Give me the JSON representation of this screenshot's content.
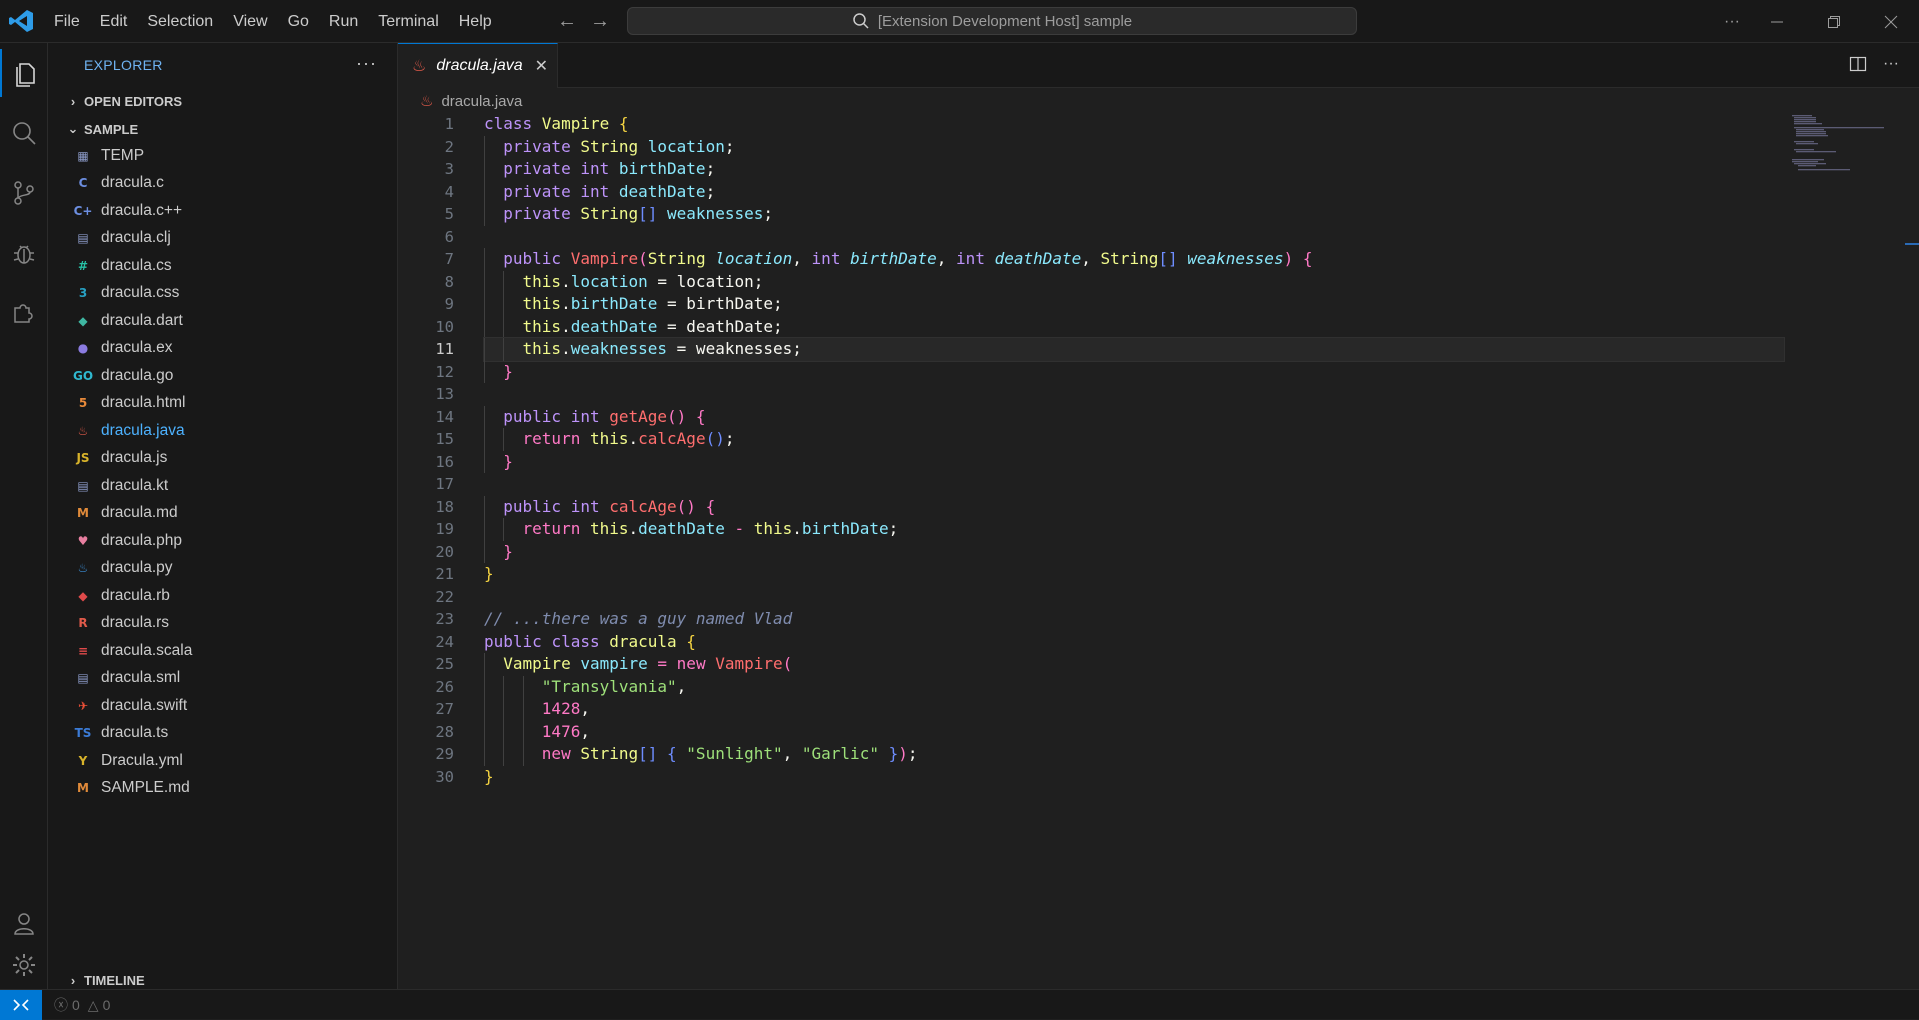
{
  "menu": [
    "File",
    "Edit",
    "Selection",
    "View",
    "Go",
    "Run",
    "Terminal",
    "Help"
  ],
  "command_center": {
    "text": "[Extension Development Host] sample"
  },
  "sidebar": {
    "title": "EXPLORER",
    "more": "···",
    "open_editors": "OPEN EDITORS",
    "workspace": "SAMPLE",
    "timeline": "TIMELINE",
    "files": [
      {
        "name": "TEMP",
        "icon": "folder-icon",
        "color": "#8b9ac7",
        "glyph": "▦"
      },
      {
        "name": "dracula.c",
        "icon": "c-file-icon",
        "color": "#6c8ee0",
        "glyph": "C"
      },
      {
        "name": "dracula.c++",
        "icon": "cpp-file-icon",
        "color": "#6c8ee0",
        "glyph": "C+"
      },
      {
        "name": "dracula.clj",
        "icon": "generic-file-icon",
        "color": "#8b9ac7",
        "glyph": "▤"
      },
      {
        "name": "dracula.cs",
        "icon": "csharp-file-icon",
        "color": "#27c2a6",
        "glyph": "#"
      },
      {
        "name": "dracula.css",
        "icon": "css-file-icon",
        "color": "#27a0c2",
        "glyph": "3"
      },
      {
        "name": "dracula.dart",
        "icon": "dart-file-icon",
        "color": "#3fb7a2",
        "glyph": "◆"
      },
      {
        "name": "dracula.ex",
        "icon": "elixir-file-icon",
        "color": "#8b7be0",
        "glyph": "●"
      },
      {
        "name": "dracula.go",
        "icon": "go-file-icon",
        "color": "#2fb8cf",
        "glyph": "GO"
      },
      {
        "name": "dracula.html",
        "icon": "html-file-icon",
        "color": "#e88a3a",
        "glyph": "5"
      },
      {
        "name": "dracula.java",
        "icon": "java-file-icon",
        "color": "#e05a4a",
        "glyph": "♨",
        "active": true
      },
      {
        "name": "dracula.js",
        "icon": "js-file-icon",
        "color": "#d8b32a",
        "glyph": "JS"
      },
      {
        "name": "dracula.kt",
        "icon": "generic-file-icon",
        "color": "#8b9ac7",
        "glyph": "▤"
      },
      {
        "name": "dracula.md",
        "icon": "markdown-file-icon",
        "color": "#e08a3a",
        "glyph": "M"
      },
      {
        "name": "dracula.php",
        "icon": "php-file-icon",
        "color": "#e87fa0",
        "glyph": "♥"
      },
      {
        "name": "dracula.py",
        "icon": "python-file-icon",
        "color": "#3b8ed6",
        "glyph": "♨"
      },
      {
        "name": "dracula.rb",
        "icon": "ruby-file-icon",
        "color": "#e04a4a",
        "glyph": "◆"
      },
      {
        "name": "dracula.rs",
        "icon": "rust-file-icon",
        "color": "#e05a4a",
        "glyph": "R"
      },
      {
        "name": "dracula.scala",
        "icon": "scala-file-icon",
        "color": "#e04a4a",
        "glyph": "≡"
      },
      {
        "name": "dracula.sml",
        "icon": "generic-file-icon",
        "color": "#8b9ac7",
        "glyph": "▤"
      },
      {
        "name": "dracula.swift",
        "icon": "swift-file-icon",
        "color": "#f05138",
        "glyph": "✈"
      },
      {
        "name": "dracula.ts",
        "icon": "ts-file-icon",
        "color": "#3b7bd6",
        "glyph": "TS"
      },
      {
        "name": "Dracula.yml",
        "icon": "yaml-file-icon",
        "color": "#d8b32a",
        "glyph": "Y"
      },
      {
        "name": "SAMPLE.md",
        "icon": "markdown-file-icon",
        "color": "#e08a3a",
        "glyph": "M"
      }
    ]
  },
  "tab": {
    "label": "dracula.java",
    "close": "✕"
  },
  "breadcrumb": {
    "file": "dracula.java"
  },
  "editor": {
    "current_line": 11,
    "lines": [
      [
        [
          "kw2",
          "class "
        ],
        [
          "cls",
          "Vampire "
        ],
        [
          "br1",
          "{"
        ]
      ],
      [
        [
          "",
          "  "
        ],
        [
          "kw2",
          "private "
        ],
        [
          "typ",
          "String "
        ],
        [
          "prop",
          "location"
        ],
        [
          "",
          ";"
        ]
      ],
      [
        [
          "",
          "  "
        ],
        [
          "kw2",
          "private "
        ],
        [
          "kw2",
          "int "
        ],
        [
          "prop",
          "birthDate"
        ],
        [
          "",
          ";"
        ]
      ],
      [
        [
          "",
          "  "
        ],
        [
          "kw2",
          "private "
        ],
        [
          "kw2",
          "int "
        ],
        [
          "prop",
          "deathDate"
        ],
        [
          "",
          ";"
        ]
      ],
      [
        [
          "",
          "  "
        ],
        [
          "kw2",
          "private "
        ],
        [
          "typ",
          "String"
        ],
        [
          "br3",
          "[]"
        ],
        [
          "prop",
          " weaknesses"
        ],
        [
          "",
          ";"
        ]
      ],
      [],
      [
        [
          "",
          "  "
        ],
        [
          "kw2",
          "public "
        ],
        [
          "fn",
          "Vampire"
        ],
        [
          "br2",
          "("
        ],
        [
          "typ",
          "String "
        ],
        [
          "param",
          "location"
        ],
        [
          "",
          ", "
        ],
        [
          "kw2",
          "int "
        ],
        [
          "param",
          "birthDate"
        ],
        [
          "",
          ", "
        ],
        [
          "kw2",
          "int "
        ],
        [
          "param",
          "deathDate"
        ],
        [
          "",
          ", "
        ],
        [
          "typ",
          "String"
        ],
        [
          "br3",
          "[]"
        ],
        [
          "param",
          " weaknesses"
        ],
        [
          "br2",
          ")"
        ],
        [
          "",
          ""
        ],
        [
          "br2",
          " {"
        ]
      ],
      [
        [
          "",
          "    "
        ],
        [
          "this",
          "this"
        ],
        [
          "",
          "."
        ],
        [
          "prop",
          "location"
        ],
        [
          "",
          " = location;"
        ]
      ],
      [
        [
          "",
          "    "
        ],
        [
          "this",
          "this"
        ],
        [
          "",
          "."
        ],
        [
          "prop",
          "birthDate"
        ],
        [
          "",
          " = birthDate;"
        ]
      ],
      [
        [
          "",
          "    "
        ],
        [
          "this",
          "this"
        ],
        [
          "",
          "."
        ],
        [
          "prop",
          "deathDate"
        ],
        [
          "",
          " = deathDate;"
        ]
      ],
      [
        [
          "",
          "    "
        ],
        [
          "this",
          "this"
        ],
        [
          "",
          "."
        ],
        [
          "prop",
          "weaknesses"
        ],
        [
          "",
          " = weaknesses;"
        ]
      ],
      [
        [
          "",
          "  "
        ],
        [
          "br2",
          "}"
        ]
      ],
      [],
      [
        [
          "",
          "  "
        ],
        [
          "kw2",
          "public "
        ],
        [
          "kw2",
          "int "
        ],
        [
          "fn",
          "getAge"
        ],
        [
          "br2",
          "() {"
        ]
      ],
      [
        [
          "",
          "    "
        ],
        [
          "kw",
          "return "
        ],
        [
          "this",
          "this"
        ],
        [
          "",
          "."
        ],
        [
          "fn",
          "calcAge"
        ],
        [
          "br3",
          "()"
        ],
        [
          "",
          ";"
        ]
      ],
      [
        [
          "",
          "  "
        ],
        [
          "br2",
          "}"
        ]
      ],
      [],
      [
        [
          "",
          "  "
        ],
        [
          "kw2",
          "public "
        ],
        [
          "kw2",
          "int "
        ],
        [
          "fn",
          "calcAge"
        ],
        [
          "br2",
          "() {"
        ]
      ],
      [
        [
          "",
          "    "
        ],
        [
          "kw",
          "return "
        ],
        [
          "this",
          "this"
        ],
        [
          "",
          "."
        ],
        [
          "prop",
          "deathDate"
        ],
        [
          "kw",
          " - "
        ],
        [
          "this",
          "this"
        ],
        [
          "",
          "."
        ],
        [
          "prop",
          "birthDate"
        ],
        [
          "",
          ";"
        ]
      ],
      [
        [
          "",
          "  "
        ],
        [
          "br2",
          "}"
        ]
      ],
      [
        [
          "br1",
          "}"
        ]
      ],
      [],
      [
        [
          "cmt",
          "// ...there was a guy named Vlad"
        ]
      ],
      [
        [
          "kw2",
          "public "
        ],
        [
          "kw2",
          "class "
        ],
        [
          "cls",
          "dracula "
        ],
        [
          "br1",
          "{"
        ]
      ],
      [
        [
          "",
          "  "
        ],
        [
          "typ",
          "Vampire "
        ],
        [
          "prop",
          "vampire"
        ],
        [
          "kw",
          " = "
        ],
        [
          "kw",
          "new "
        ],
        [
          "fn",
          "Vampire"
        ],
        [
          "br2",
          "("
        ]
      ],
      [
        [
          "",
          "      "
        ],
        [
          "str",
          "\"Transylvania\""
        ],
        [
          "",
          ","
        ]
      ],
      [
        [
          "",
          "      "
        ],
        [
          "num",
          "1428"
        ],
        [
          "",
          ","
        ]
      ],
      [
        [
          "",
          "      "
        ],
        [
          "num",
          "1476"
        ],
        [
          "",
          ","
        ]
      ],
      [
        [
          "",
          "      "
        ],
        [
          "kw",
          "new "
        ],
        [
          "typ",
          "String"
        ],
        [
          "br3",
          "[] { "
        ],
        [
          "str",
          "\"Sunlight\""
        ],
        [
          "",
          ", "
        ],
        [
          "str",
          "\"Garlic\""
        ],
        [
          "br3",
          " }"
        ],
        [
          "br2",
          ")"
        ],
        [
          "",
          ";"
        ]
      ],
      [
        [
          "br1",
          "}"
        ]
      ]
    ]
  },
  "status": {
    "errors": "0",
    "warnings": "0"
  },
  "colors": {
    "accent": "#0078d4",
    "bg": "#1f1f1f",
    "sidebar_bg": "#181818"
  }
}
